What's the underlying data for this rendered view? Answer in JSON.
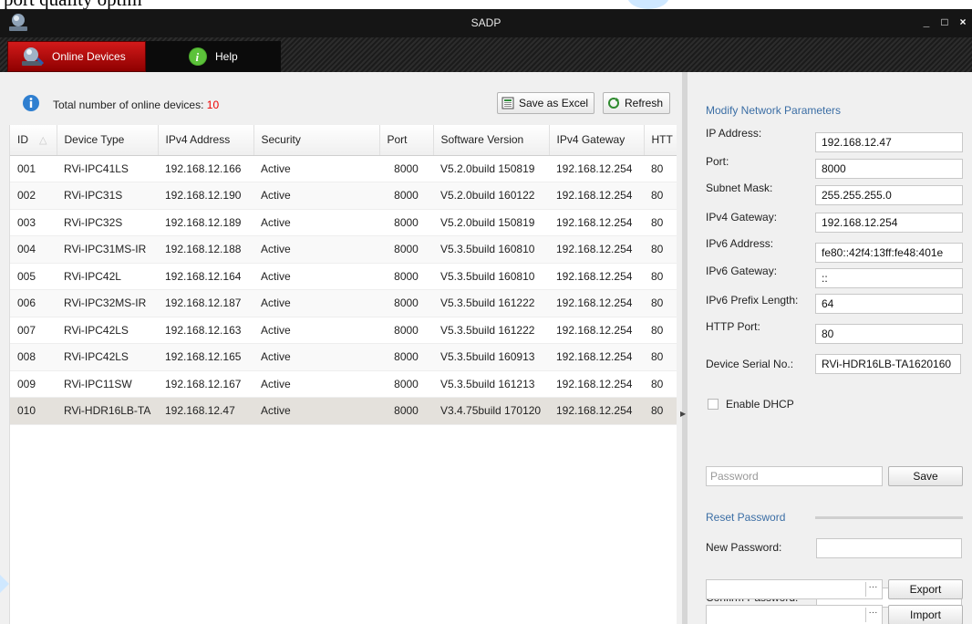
{
  "doc_snippet": "port quality optim",
  "window": {
    "title": "SADP",
    "controls": {
      "minimize": "_",
      "maximize": "□",
      "close": "×"
    }
  },
  "menu": {
    "online_devices": "Online Devices",
    "help": "Help"
  },
  "summary": {
    "total_label": "Total number of online devices:",
    "total_count": "10",
    "save_excel": "Save as Excel",
    "refresh": "Refresh"
  },
  "table": {
    "columns": [
      "ID",
      "Device Type",
      "IPv4 Address",
      "Security",
      "Port",
      "Software Version",
      "IPv4 Gateway",
      "HTT"
    ],
    "rows": [
      [
        "001",
        "RVi-IPC41LS",
        "192.168.12.166",
        "Active",
        "8000",
        "V5.2.0build 150819",
        "192.168.12.254",
        "80"
      ],
      [
        "002",
        "RVi-IPC31S",
        "192.168.12.190",
        "Active",
        "8000",
        "V5.2.0build 160122",
        "192.168.12.254",
        "80"
      ],
      [
        "003",
        "RVi-IPC32S",
        "192.168.12.189",
        "Active",
        "8000",
        "V5.2.0build 150819",
        "192.168.12.254",
        "80"
      ],
      [
        "004",
        "RVi-IPC31MS-IR",
        "192.168.12.188",
        "Active",
        "8000",
        "V5.3.5build 160810",
        "192.168.12.254",
        "80"
      ],
      [
        "005",
        "RVi-IPC42L",
        "192.168.12.164",
        "Active",
        "8000",
        "V5.3.5build 160810",
        "192.168.12.254",
        "80"
      ],
      [
        "006",
        "RVi-IPC32MS-IR",
        "192.168.12.187",
        "Active",
        "8000",
        "V5.3.5build 161222",
        "192.168.12.254",
        "80"
      ],
      [
        "007",
        "RVi-IPC42LS",
        "192.168.12.163",
        "Active",
        "8000",
        "V5.3.5build 161222",
        "192.168.12.254",
        "80"
      ],
      [
        "008",
        "RVi-IPC42LS",
        "192.168.12.165",
        "Active",
        "8000",
        "V5.3.5build 160913",
        "192.168.12.254",
        "80"
      ],
      [
        "009",
        "RVi-IPC11SW",
        "192.168.12.167",
        "Active",
        "8000",
        "V5.3.5build 161213",
        "192.168.12.254",
        "80"
      ],
      [
        "010",
        "RVi-HDR16LB-TA",
        "192.168.12.47",
        "Active",
        "8000",
        "V3.4.75build 170120",
        "192.168.12.254",
        "80"
      ]
    ],
    "selected_row": 9
  },
  "modify": {
    "title": "Modify Network Parameters",
    "fields": [
      {
        "label": "IP Address:",
        "value": "192.168.12.47"
      },
      {
        "label": "Port:",
        "value": "8000"
      },
      {
        "label": "Subnet Mask:",
        "value": "255.255.255.0"
      },
      {
        "label": "IPv4 Gateway:",
        "value": "192.168.12.254"
      },
      {
        "label": "IPv6 Address:",
        "value": "fe80::42f4:13ff:fe48:401e"
      },
      {
        "label": "IPv6 Gateway:",
        "value": "::"
      },
      {
        "label": "IPv6 Prefix Length:",
        "value": "64"
      },
      {
        "label": "HTTP Port:",
        "value": "80"
      },
      {
        "label": "Device Serial No.:",
        "value": "RVi-HDR16LB-TA1620160"
      }
    ],
    "enable_dhcp": "Enable DHCP",
    "password_placeholder": "Password",
    "save": "Save"
  },
  "reset": {
    "title": "Reset Password",
    "new_password": "New Password:",
    "confirm_password": "Confirm Password:",
    "dots": "···",
    "export": "Export",
    "import": "Import"
  },
  "colors": {
    "accent_red": "#c00000",
    "count_red": "#e00000",
    "section_blue": "#3b6ea5",
    "title_bar": "#151515"
  }
}
